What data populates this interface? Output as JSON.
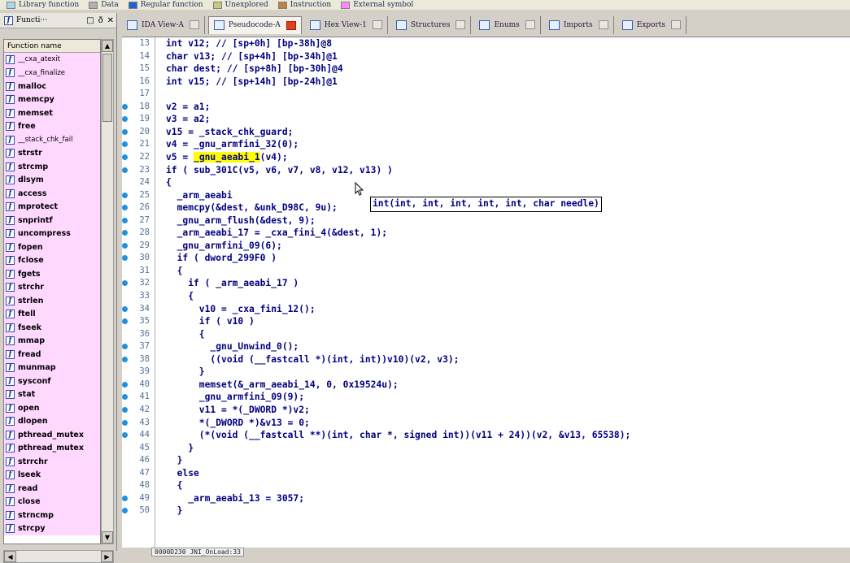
{
  "legend": [
    {
      "label": "Library function",
      "color": "#a8d8f0"
    },
    {
      "label": "Data",
      "color": "#b0b0b0"
    },
    {
      "label": "Regular function",
      "color": "#2060d0"
    },
    {
      "label": "Unexplored",
      "color": "#c8c880"
    },
    {
      "label": "Instruction",
      "color": "#c08040"
    },
    {
      "label": "External symbol",
      "color": "#ff88ff"
    }
  ],
  "function_panel": {
    "title": "Functi···",
    "header": "Function name",
    "items": [
      "__cxa_atexit",
      "__cxa_finalize",
      "malloc",
      "memcpy",
      "memset",
      "free",
      "__stack_chk_fail",
      "strstr",
      "strcmp",
      "dlsym",
      "access",
      "mprotect",
      "snprintf",
      "uncompress",
      "fopen",
      "fclose",
      "fgets",
      "strchr",
      "strlen",
      "ftell",
      "fseek",
      "mmap",
      "fread",
      "munmap",
      "sysconf",
      "stat",
      "open",
      "dlopen",
      "pthread_mutex",
      "pthread_mutex",
      "strrchr",
      "lseek",
      "read",
      "close",
      "strncmp",
      "strcpy"
    ]
  },
  "tabs": [
    {
      "label": "IDA View-A",
      "active": false,
      "close_red": false
    },
    {
      "label": "Pseudocode-A",
      "active": true,
      "close_red": true
    },
    {
      "label": "Hex View-1",
      "active": false,
      "close_red": false
    },
    {
      "label": "Structures",
      "active": false,
      "close_red": false
    },
    {
      "label": "Enums",
      "active": false,
      "close_red": false
    },
    {
      "label": "Imports",
      "active": false,
      "close_red": false
    },
    {
      "label": "Exports",
      "active": false,
      "close_red": false
    }
  ],
  "code_lines": [
    {
      "n": "13",
      "dot": false,
      "text": "int v12; // [sp+0h] [bp-38h]@8"
    },
    {
      "n": "14",
      "dot": false,
      "text": "char v13; // [sp+4h] [bp-34h]@1"
    },
    {
      "n": "15",
      "dot": false,
      "text": "char dest; // [sp+8h] [bp-30h]@4"
    },
    {
      "n": "16",
      "dot": false,
      "text": "int v15; // [sp+14h] [bp-24h]@1"
    },
    {
      "n": "17",
      "dot": false,
      "text": ""
    },
    {
      "n": "18",
      "dot": true,
      "text": "v2 = a1;"
    },
    {
      "n": "19",
      "dot": true,
      "text": "v3 = a2;"
    },
    {
      "n": "20",
      "dot": true,
      "text": "v15 = _stack_chk_guard;"
    },
    {
      "n": "21",
      "dot": true,
      "text": "v4 = _gnu_armfini_32(0);"
    },
    {
      "n": "22",
      "dot": true,
      "text": "v5 = _gnu_aeabi_1(v4);"
    },
    {
      "n": "23",
      "dot": true,
      "text": "if ( sub_301C(v5, v6, v7, v8, v12, v13) )"
    },
    {
      "n": "24",
      "dot": false,
      "text": "{"
    },
    {
      "n": "25",
      "dot": true,
      "text": "  _arm_aeabi"
    },
    {
      "n": "26",
      "dot": true,
      "text": "  memcpy(&dest, &unk_D98C, 9u);"
    },
    {
      "n": "27",
      "dot": true,
      "text": "  _gnu_arm_flush(&dest, 9);"
    },
    {
      "n": "28",
      "dot": true,
      "text": "  _arm_aeabi_17 = _cxa_fini_4(&dest, 1);"
    },
    {
      "n": "29",
      "dot": true,
      "text": "  _gnu_armfini_09(6);"
    },
    {
      "n": "30",
      "dot": true,
      "text": "  if ( dword_299F0 )"
    },
    {
      "n": "31",
      "dot": false,
      "text": "  {"
    },
    {
      "n": "32",
      "dot": true,
      "text": "    if ( _arm_aeabi_17 )"
    },
    {
      "n": "33",
      "dot": false,
      "text": "    {"
    },
    {
      "n": "34",
      "dot": true,
      "text": "      v10 = _cxa_fini_12();"
    },
    {
      "n": "35",
      "dot": true,
      "text": "      if ( v10 )"
    },
    {
      "n": "36",
      "dot": false,
      "text": "      {"
    },
    {
      "n": "37",
      "dot": true,
      "text": "        _gnu_Unwind_0();"
    },
    {
      "n": "38",
      "dot": true,
      "text": "        ((void (__fastcall *)(int, int))v10)(v2, v3);"
    },
    {
      "n": "39",
      "dot": false,
      "text": "      }"
    },
    {
      "n": "40",
      "dot": true,
      "text": "      memset(&_arm_aeabi_14, 0, 0x19524u);"
    },
    {
      "n": "41",
      "dot": true,
      "text": "      _gnu_armfini_09(9);"
    },
    {
      "n": "42",
      "dot": true,
      "text": "      v11 = *(_DWORD *)v2;"
    },
    {
      "n": "43",
      "dot": true,
      "text": "      *(_DWORD *)&v13 = 0;"
    },
    {
      "n": "44",
      "dot": true,
      "text": "      (*(void (__fastcall **)(int, char *, signed int))(v11 + 24))(v2, &v13, 65538);"
    },
    {
      "n": "45",
      "dot": false,
      "text": "    }"
    },
    {
      "n": "46",
      "dot": false,
      "text": "  }"
    },
    {
      "n": "47",
      "dot": false,
      "text": "  else"
    },
    {
      "n": "48",
      "dot": false,
      "text": "  {"
    },
    {
      "n": "49",
      "dot": true,
      "text": "    _arm_aeabi_13 = 3057;"
    },
    {
      "n": "50",
      "dot": true,
      "text": "  }"
    }
  ],
  "tooltip": "int(int, int, int, int, int, char needle)",
  "status": "0000D230 JNI_OnLoad:33"
}
